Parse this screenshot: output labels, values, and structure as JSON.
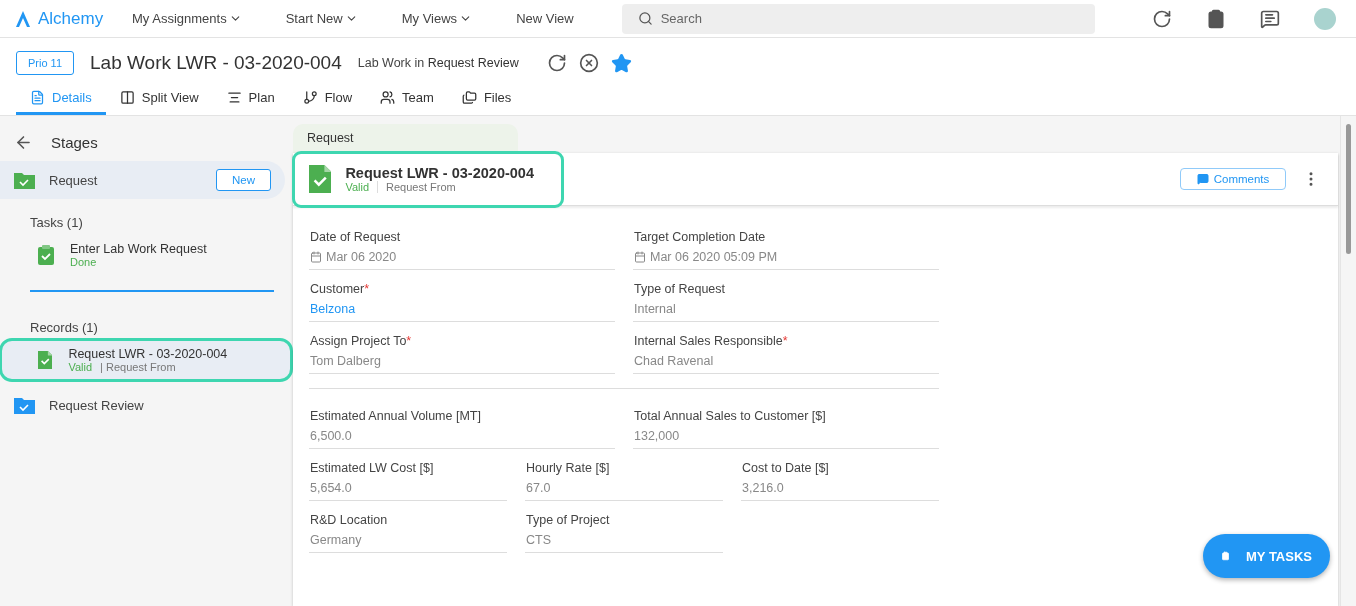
{
  "topbar": {
    "logo": "Alchemy",
    "nav": [
      {
        "label": "My Assignments",
        "dropdown": true
      },
      {
        "label": "Start New",
        "dropdown": true
      },
      {
        "label": "My Views",
        "dropdown": true
      },
      {
        "label": "New View",
        "dropdown": false
      }
    ],
    "search": {
      "placeholder": "Search"
    }
  },
  "header": {
    "priority": "Prio 11",
    "title": "Lab Work LWR - 03-2020-004",
    "subtitle": "Lab Work in **Request Review**",
    "starred": true,
    "tabs": [
      {
        "label": "Details",
        "kind": "details",
        "selected": true
      },
      {
        "label": "Split View",
        "kind": "split",
        "selected": false
      },
      {
        "label": "Plan",
        "kind": "plan",
        "selected": false
      },
      {
        "label": "Flow",
        "kind": "flow",
        "selected": false
      },
      {
        "label": "Team",
        "kind": "team",
        "selected": false
      },
      {
        "label": "Files",
        "kind": "files",
        "selected": false
      }
    ]
  },
  "sidebar": {
    "title": "Stages",
    "stages": [
      {
        "label": "Request",
        "color": "#4caf50",
        "selected": true,
        "button": "New",
        "tasks_heading": "Tasks (1)",
        "tasks": [
          {
            "name": "Enter Lab Work Request",
            "status": "Done"
          }
        ],
        "records_heading": "Records (1)",
        "records": [
          {
            "name": "Request LWR - 03-2020-004",
            "status": "Valid",
            "form": "| Request From",
            "selected": true,
            "highlighted": true
          }
        ]
      },
      {
        "label": "Request Review",
        "color": "#2196f3",
        "selected": false
      }
    ]
  },
  "record": {
    "stage_tab": "Request",
    "title": "Request LWR - 03-2020-004",
    "status": "Valid",
    "form": "Request From",
    "highlighted": true,
    "comments_button": "Comments",
    "sections": [
      {
        "rows": [
          {
            "kind": "halves",
            "fields": [
              {
                "label": "Date of Request",
                "value": "Mar 06 2020",
                "kind": "date",
                "required": false
              },
              {
                "label": "Target Completion Date",
                "value": "Mar 06 2020 05:09 PM",
                "kind": "date",
                "required": false
              }
            ]
          },
          {
            "kind": "halves",
            "fields": [
              {
                "label": "Customer",
                "value": "Belzona",
                "kind": "link",
                "required": true
              },
              {
                "label": "Type of Request",
                "value": "Internal",
                "kind": "text",
                "required": false
              }
            ]
          },
          {
            "kind": "halves",
            "fields": [
              {
                "label": "Assign Project To",
                "value": "Tom Dalberg",
                "kind": "text",
                "required": true
              },
              {
                "label": "Internal Sales Responsible",
                "value": "Chad Ravenal",
                "kind": "text",
                "required": true
              }
            ]
          }
        ]
      },
      {
        "rows": [
          {
            "kind": "halves",
            "fields": [
              {
                "label": "Estimated Annual Volume [MT]",
                "value": "6,500.0",
                "kind": "text",
                "required": false
              },
              {
                "label": "Total Annual Sales to Customer [$]",
                "value": "132,000",
                "kind": "text",
                "required": false
              }
            ]
          },
          {
            "kind": "thirds",
            "fields": [
              {
                "label": "Estimated LW Cost [$]",
                "value": "5,654.0",
                "kind": "text",
                "required": false
              },
              {
                "label": "Hourly Rate [$]",
                "value": "67.0",
                "kind": "text",
                "required": false
              },
              {
                "label": "Cost to Date [$]",
                "value": "3,216.0",
                "kind": "text",
                "required": false
              }
            ]
          },
          {
            "kind": "thirds",
            "fields": [
              {
                "label": "R&D Location",
                "value": "Germany",
                "kind": "text",
                "required": false
              },
              {
                "label": "Type of Project",
                "value": "CTS",
                "kind": "text",
                "required": false
              }
            ]
          }
        ]
      }
    ],
    "required_mark": "*"
  },
  "fab": {
    "label": "MY TASKS"
  }
}
